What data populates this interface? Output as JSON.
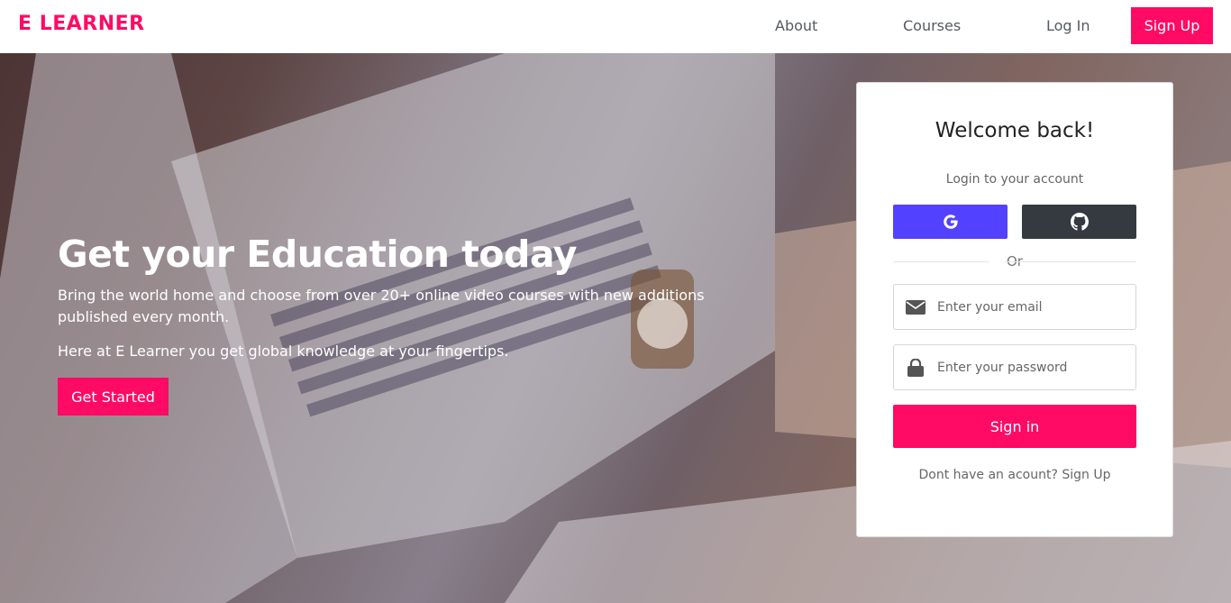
{
  "brand": {
    "name": "E LEARNER",
    "color": "#ff0a64"
  },
  "nav": {
    "about": "About",
    "courses": "Courses",
    "login": "Log In",
    "signup": "Sign Up"
  },
  "hero": {
    "title": "Get your Education today",
    "description": "Bring the world home and choose from over 20+ online video courses with new additions published every month.",
    "description2": "Here at E Learner you get global knowledge at your fingertips.",
    "cta": "Get Started"
  },
  "login_card": {
    "title": "Welcome back!",
    "subtitle": "Login to your account",
    "google_icon": "google-icon",
    "github_icon": "github-icon",
    "divider": "Or",
    "email_placeholder": "Enter your email",
    "password_placeholder": "Enter your password",
    "signin": "Sign in",
    "footer_text": "Dont have an acount?",
    "footer_link": "Sign Up"
  },
  "colors": {
    "accent": "#ff0a64",
    "google": "#5241ff",
    "github": "#343a40"
  }
}
